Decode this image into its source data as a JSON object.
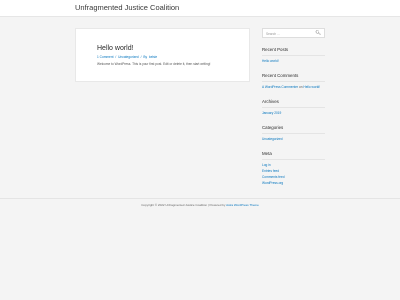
{
  "header": {
    "site_title": "Unfragmented Justice Coalition"
  },
  "post": {
    "title": "Hello world!",
    "meta": {
      "comments": "1 Comment",
      "sep1": "/",
      "category": "Uncategorized",
      "sep2": "/",
      "by": "By",
      "author": "kelsie"
    },
    "excerpt": "Welcome to WordPress. This is your first post. Edit or delete it, then start writing!"
  },
  "sidebar": {
    "search_placeholder": "Search …",
    "search_icon": "search-icon",
    "recent_posts": {
      "title": "Recent Posts",
      "items": [
        "Hello world!"
      ]
    },
    "recent_comments": {
      "title": "Recent Comments",
      "author": "A WordPress Commenter",
      "on": "on",
      "post": "Hello world!"
    },
    "archives": {
      "title": "Archives",
      "items": [
        "January 2019"
      ]
    },
    "categories": {
      "title": "Categories",
      "items": [
        "Uncategorized"
      ]
    },
    "meta": {
      "title": "Meta",
      "items": [
        "Log in",
        "Entries feed",
        "Comments feed",
        "WordPress.org"
      ]
    }
  },
  "footer": {
    "copyright": "Copyright © 2022 Unfragmented Justice Coalition | Powered by",
    "theme_link": "Astra WordPress Theme"
  },
  "colors": {
    "link": "#0274be",
    "background": "#f4f4f4",
    "text": "#3a3a3a"
  }
}
